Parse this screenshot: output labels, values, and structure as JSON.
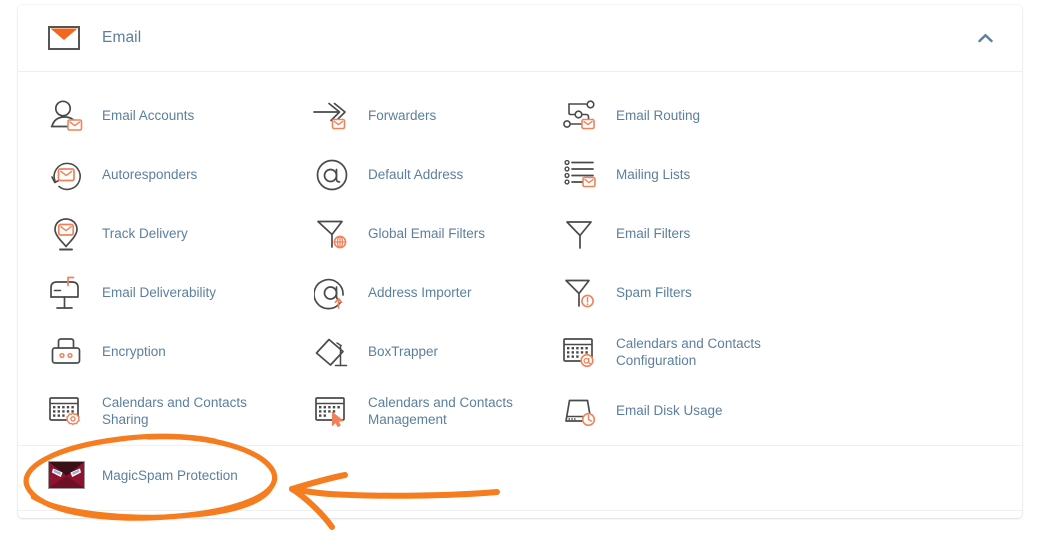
{
  "header": {
    "title": "Email",
    "icon": "envelope-icon",
    "collapse_icon": "chevron-up-icon",
    "collapsed": false
  },
  "colors": {
    "label_text": "#5b7f9e",
    "icon_line": "#4a4a4a",
    "icon_accent": "#f0825a",
    "brand_orange": "#f3661c",
    "annotation_orange": "#f57c1f",
    "card_background": "#ffffff",
    "divider": "#eaeff5",
    "magicspam_red": "#8f1230"
  },
  "items": [
    {
      "label": "Email Accounts",
      "icon": "user-with-envelope-icon",
      "column": 0,
      "row": 0
    },
    {
      "label": "Forwarders",
      "icon": "arrow-forward-envelope-icon",
      "column": 1,
      "row": 0
    },
    {
      "label": "Email Routing",
      "icon": "routing-nodes-envelope-icon",
      "column": 2,
      "row": 0
    },
    {
      "label": "Autoresponders",
      "icon": "circular-arrow-envelope-icon",
      "column": 0,
      "row": 1
    },
    {
      "label": "Default Address",
      "icon": "at-sign-circle-icon",
      "column": 1,
      "row": 1
    },
    {
      "label": "Mailing Lists",
      "icon": "list-envelope-icon",
      "column": 2,
      "row": 1
    },
    {
      "label": "Track Delivery",
      "icon": "map-pin-envelope-icon",
      "column": 0,
      "row": 2
    },
    {
      "label": "Global Email Filters",
      "icon": "funnel-globe-icon",
      "column": 1,
      "row": 2
    },
    {
      "label": "Email Filters",
      "icon": "funnel-icon",
      "column": 2,
      "row": 2
    },
    {
      "label": "Email Deliverability",
      "icon": "mailbox-icon",
      "column": 0,
      "row": 3
    },
    {
      "label": "Address Importer",
      "icon": "at-sign-upload-icon",
      "column": 1,
      "row": 3
    },
    {
      "label": "Spam Filters",
      "icon": "funnel-alert-icon",
      "column": 2,
      "row": 3
    },
    {
      "label": "Encryption",
      "icon": "padlock-icon",
      "column": 0,
      "row": 4
    },
    {
      "label": "BoxTrapper",
      "icon": "box-trap-icon",
      "column": 1,
      "row": 4
    },
    {
      "label": "Calendars and Contacts\nConfiguration",
      "icon": "calendar-at-icon",
      "column": 2,
      "row": 4
    },
    {
      "label": "Calendars and Contacts\nSharing",
      "icon": "calendar-gear-icon",
      "column": 0,
      "row": 5
    },
    {
      "label": "Calendars and Contacts\nManagement",
      "icon": "calendar-cursor-icon",
      "column": 1,
      "row": 5
    },
    {
      "label": "Email Disk Usage",
      "icon": "disk-clock-icon",
      "column": 2,
      "row": 5
    }
  ],
  "magicspam": {
    "label": "MagicSpam Protection",
    "icon": "magicspam-angry-envelope-icon"
  },
  "annotations": {
    "ellipse": {
      "shape": "hand-drawn-ellipse",
      "target": "MagicSpam Protection"
    },
    "arrow": {
      "shape": "hand-drawn-arrow-left",
      "target": "MagicSpam Protection"
    }
  }
}
